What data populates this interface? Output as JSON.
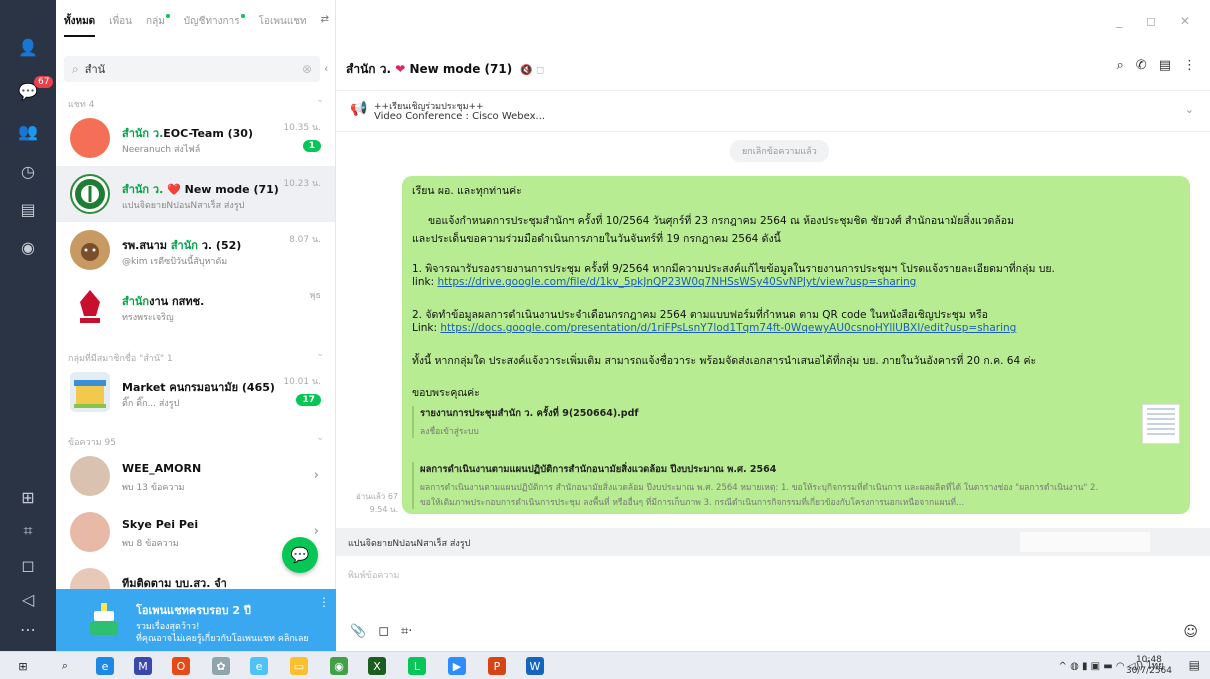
{
  "tabs": [
    {
      "label": "ทั้งหมด",
      "active": true
    },
    {
      "label": "เพื่อน",
      "active": false
    },
    {
      "label": "กลุ่ม",
      "active": false,
      "dot": true
    },
    {
      "label": "บัญชีทางการ",
      "active": false,
      "dot": true
    },
    {
      "label": "โอเพนแชท",
      "active": false
    }
  ],
  "rail": {
    "badge": "67"
  },
  "search": {
    "value": "สำนั"
  },
  "sections": {
    "chats": "แชท 4",
    "groups": "กลุ่มที่มีสมาชิกชื่อ \"สำนั\" 1",
    "messages": "ข้อความ 95"
  },
  "chat_items": [
    {
      "name_hl": "สำนัก ว.",
      "name_rest": "EOC-Team (30)",
      "sub": "Neeranuch ส่งไฟล์",
      "time": "10.35 น.",
      "count": "1"
    },
    {
      "name_hl": "สำนัก ว.",
      "name_rest": " ❤️ New mode (71)",
      "sub": "แปนจิดยายNปอนNสาเร็ส ส่งรูป",
      "time": "10.23 น."
    },
    {
      "name_pre": "รพ.สนาม ",
      "name_hl": "สำนัก",
      "name_rest": " ว. (52)",
      "sub": "@kim เรดีซป้วันนี้สับุหาดัม",
      "time": "8.07 น."
    },
    {
      "name_hl": "สำนัก",
      "name_rest": "งาน กสทช.",
      "sub": "ทรงพระเจริญ",
      "time": "พุธ"
    }
  ],
  "group_items": [
    {
      "name": "Market คนกรมอนามัย (465)",
      "sub": "ติ๊ก ติ๊ก... ส่งรูป",
      "time": "10.01 น.",
      "count": "17"
    }
  ],
  "message_items": [
    {
      "name": "WEE_AMORN",
      "sub": "พบ 13 ข้อความ"
    },
    {
      "name": "Skye Pei Pei",
      "sub": "พบ 8 ข้อความ"
    },
    {
      "name": "ทีมติดตาม บบ.สว. จำ",
      "sub": ""
    }
  ],
  "promo": {
    "title": "โอเพนแชทครบรอบ 2 ปี",
    "line1": "รวมเรื่องสุดว้าว!",
    "line2": "ที่คุณอาจไม่เคยรู้เกี่ยวกับโอเพนแชท คลิกเลย"
  },
  "chat": {
    "title_pre": "สำนัก ว.",
    "title_rest": "New mode (71)",
    "announcement": {
      "title": "++เรียนเชิญร่วมประชุม++",
      "sub": "Video Conference : Cisco Webex..."
    },
    "system_note": "ยกเลิกข้อความแล้ว",
    "message": {
      "l1": "เรียน ผอ. และทุกท่านค่ะ",
      "l2": "ขอแจ้งกำหนดการประชุมสำนักฯ ครั้งที่ 10/2564 วันศุกร์ที่ 23 กรกฎาคม 2564 ณ ห้องประชุมชิด ชัยวงศ์ สำนักอนามัยสิ่งแวดล้อม",
      "l3": "และประเด็นขอความร่วมมือดำเนินการภายในวันจันทร์ที่ 19 กรกฎาคม 2564 ดังนี้",
      "l4": "1. พิจารณารับรองรายงานการประชุม ครั้งที่ 9/2564 หากมีความประสงค์แก้ไขข้อมูลในรายงานการประชุมฯ โปรดแจ้งรายละเอียดมาที่กลุ่ม บย.",
      "l5_label": "link: ",
      "l5_link": "https://drive.google.com/file/d/1kv_5pkJnQP23W0q7NHSsWSy40SvNPJyt/view?usp=sharing",
      "l6": "2. จัดทำข้อมูลผลการดำเนินงานประจำเดือนกรกฎาคม 2564 ตามแบบฟอร์มที่กำหนด ตาม QR code ในหนังสือเชิญประชุม หรือ",
      "l7_label": "Link: ",
      "l7_link": "https://docs.google.com/presentation/d/1riFPsLsnY7lod1Tqm74ft-0WqewyAU0csnoHYllUBXI/edit?usp=sharing",
      "l8": "ทั้งนี้ หากกลุ่มใด ประสงค์แจ้งวาระเพิ่มเติม สามารถแจ้งชื่อวาระ พร้อมจัดส่งเอกสารนำเสนอได้ที่กลุ่ม บย. ภายในวันอังคารที่ 20 ก.ค. 64 ค่ะ",
      "l9": "ขอบพระคุณค่ะ",
      "card1_title": "รายงานการประชุมสำนัก ว. ครั้งที่ 9(250664).pdf",
      "card1_sub": "ลงชื่อเข้าสู่ระบบ",
      "card2_title": "ผลการดำเนินงานตามแผนปฏิบัติการสำนักอนามัยสิ่งแวดล้อม ปีงบประมาณ พ.ศ. 2564",
      "card2_sub1": "ผลการดำเนินงานตามแผนปฏิบัติการ สำนักอนามัยสิ่งแวดล้อม ปีงบประมาณ พ.ศ. 2564 หมายเหตุ: 1. ขอให้ระบุกิจกรรมที่ดำเนินการ และผลผลิตที่ได้ ในตารางช่อง \"ผลการดำเนินงาน\" 2.",
      "card2_sub2": "ขอให้เติมภาพประกอบการดำเนินการประชุม ลงพื้นที่ หรืออื่นๆ ที่มีการเก็บภาพ 3. กรณีดำเนินการกิจกรรมที่เกี่ยวข้องกับโครงการนอกเหนือจากแผนที่...",
      "read": "อ่านแล้ว 67",
      "time": "9.54 น."
    },
    "reply_text": "แปนจิดยายNปอนNสาเร็ส ส่งรูป",
    "input_placeholder": "พิมพ์ข้อความ"
  },
  "taskbar": {
    "lang": "ไทย",
    "time": "10:48",
    "date": "30/7/2564"
  }
}
